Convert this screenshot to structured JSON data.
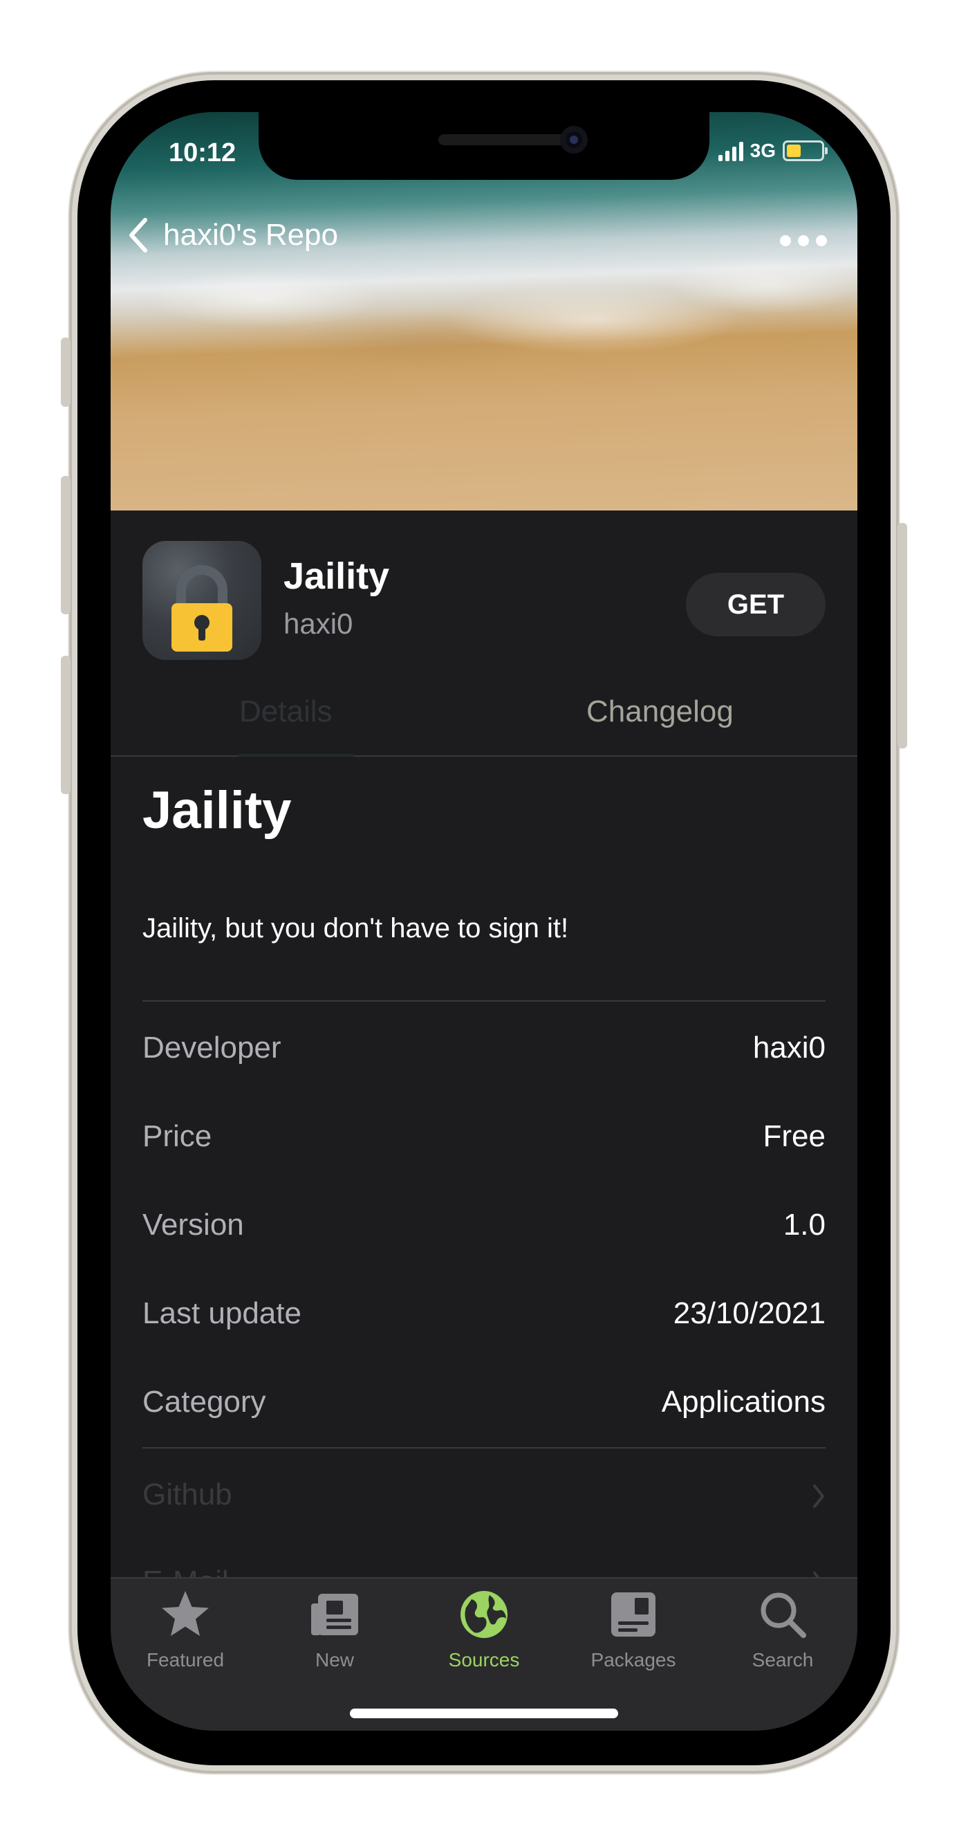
{
  "status": {
    "time": "10:12",
    "network": "3G"
  },
  "nav": {
    "back_label": "haxi0's Repo"
  },
  "app": {
    "name": "Jaility",
    "developer": "haxi0",
    "get_label": "GET"
  },
  "tabs": [
    {
      "label": "Details",
      "active": true
    },
    {
      "label": "Changelog",
      "active": false
    }
  ],
  "details": {
    "title": "Jaility",
    "description": "Jaility, but you don't have to sign it!",
    "rows": [
      {
        "key": "Developer",
        "value": "haxi0"
      },
      {
        "key": "Price",
        "value": "Free"
      },
      {
        "key": "Version",
        "value": "1.0"
      },
      {
        "key": "Last update",
        "value": "23/10/2021"
      },
      {
        "key": "Category",
        "value": "Applications"
      }
    ],
    "links": [
      {
        "label": "Github"
      },
      {
        "label": "E-Mail"
      }
    ]
  },
  "tabbar": [
    {
      "label": "Featured",
      "icon": "star-icon"
    },
    {
      "label": "New",
      "icon": "newspaper-icon"
    },
    {
      "label": "Sources",
      "icon": "globe-icon",
      "active": true
    },
    {
      "label": "Packages",
      "icon": "package-icon"
    },
    {
      "label": "Search",
      "icon": "search-icon"
    }
  ],
  "colors": {
    "accent": "#9bd461",
    "background": "#1c1c1e",
    "lock": "#f7c233"
  }
}
